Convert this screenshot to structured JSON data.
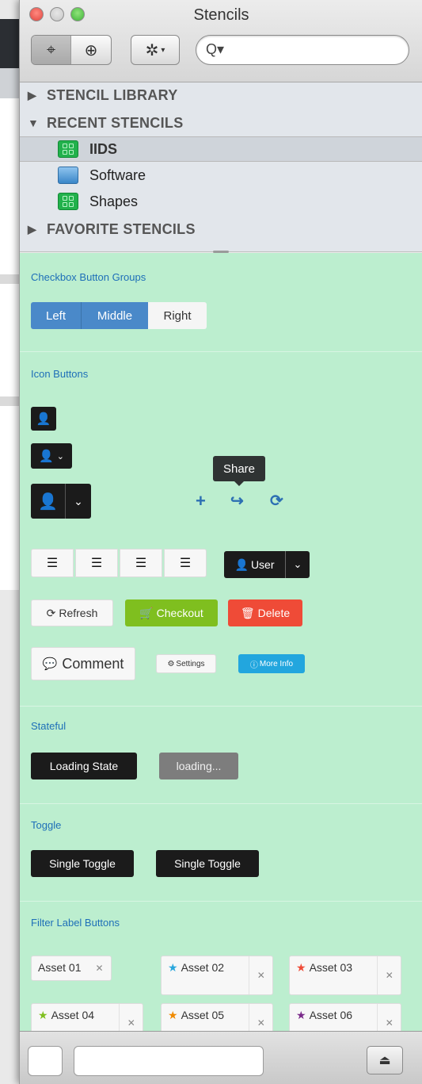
{
  "window": {
    "title": "Stencils"
  },
  "toolbar": {
    "search_placeholder": ""
  },
  "library": {
    "sections": [
      {
        "label": "STENCIL LIBRARY",
        "expanded": false
      },
      {
        "label": "RECENT STENCILS",
        "expanded": true
      },
      {
        "label": "FAVORITE STENCILS",
        "expanded": false
      }
    ],
    "recent": [
      {
        "label": "IIDS",
        "icon": "stencil-grid-icon",
        "selected": true
      },
      {
        "label": "Software",
        "icon": "folder-icon",
        "selected": false
      },
      {
        "label": "Shapes",
        "icon": "stencil-grid-icon",
        "selected": false
      }
    ]
  },
  "content": {
    "checkbox_groups": {
      "title": "Checkbox Button Groups",
      "buttons": [
        "Left",
        "Middle",
        "Right"
      ]
    },
    "icon_buttons": {
      "title": "Icon Buttons",
      "tooltip": "Share"
    },
    "user_button": "User",
    "refresh": "Refresh",
    "checkout": "Checkout",
    "delete": "Delete",
    "comment": "Comment",
    "settings": "Settings",
    "more_info": "More Info",
    "stateful": {
      "title": "Stateful",
      "loading_state": "Loading State",
      "loading": "loading..."
    },
    "toggle": {
      "title": "Toggle",
      "single1": "Single Toggle",
      "single2": "Single Toggle"
    },
    "filter": {
      "title": "Filter Label Buttons",
      "assets": [
        {
          "label": "Asset 01",
          "star": null
        },
        {
          "label": "Asset 02",
          "star": "#2aa7dd"
        },
        {
          "label": "Asset 03",
          "star": "#ef4b37"
        },
        {
          "label": "Asset 04",
          "star": "#7fbf1f"
        },
        {
          "label": "Asset 05",
          "star": "#f08a00"
        },
        {
          "label": "Asset 06",
          "star": "#7a2a8a"
        }
      ]
    }
  }
}
